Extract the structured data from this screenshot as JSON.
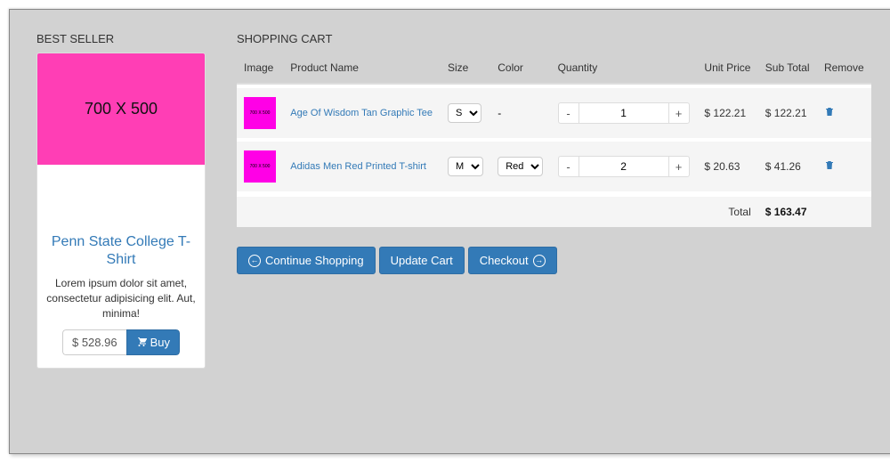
{
  "sidebar": {
    "title": "BEST SELLER",
    "product": {
      "img_text": "700 X 500",
      "name": "Penn State College T-Shirt",
      "desc": "Lorem ipsum dolor sit amet, consectetur adipisicing elit. Aut, minima!",
      "price": "$ 528.96",
      "buy_label": "Buy"
    }
  },
  "cart": {
    "title": "SHOPPING CART",
    "columns": {
      "image": "Image",
      "name": "Product Name",
      "size": "Size",
      "color": "Color",
      "qty": "Quantity",
      "unit": "Unit Price",
      "sub": "Sub Total",
      "remove": "Remove"
    },
    "items": [
      {
        "thumb_text": "700 X 500",
        "name": "Age Of Wisdom Tan Graphic Tee",
        "size": "S",
        "color": "-",
        "qty": "1",
        "unit": "$ 122.21",
        "sub": "$ 122.21"
      },
      {
        "thumb_text": "700 X 500",
        "name": "Adidas Men Red Printed T-shirt",
        "size": "M",
        "color": "Red",
        "qty": "2",
        "unit": "$ 20.63",
        "sub": "$ 41.26"
      }
    ],
    "total_label": "Total",
    "total": "$ 163.47",
    "actions": {
      "continue": "Continue Shopping",
      "update": "Update Cart",
      "checkout": "Checkout"
    }
  }
}
